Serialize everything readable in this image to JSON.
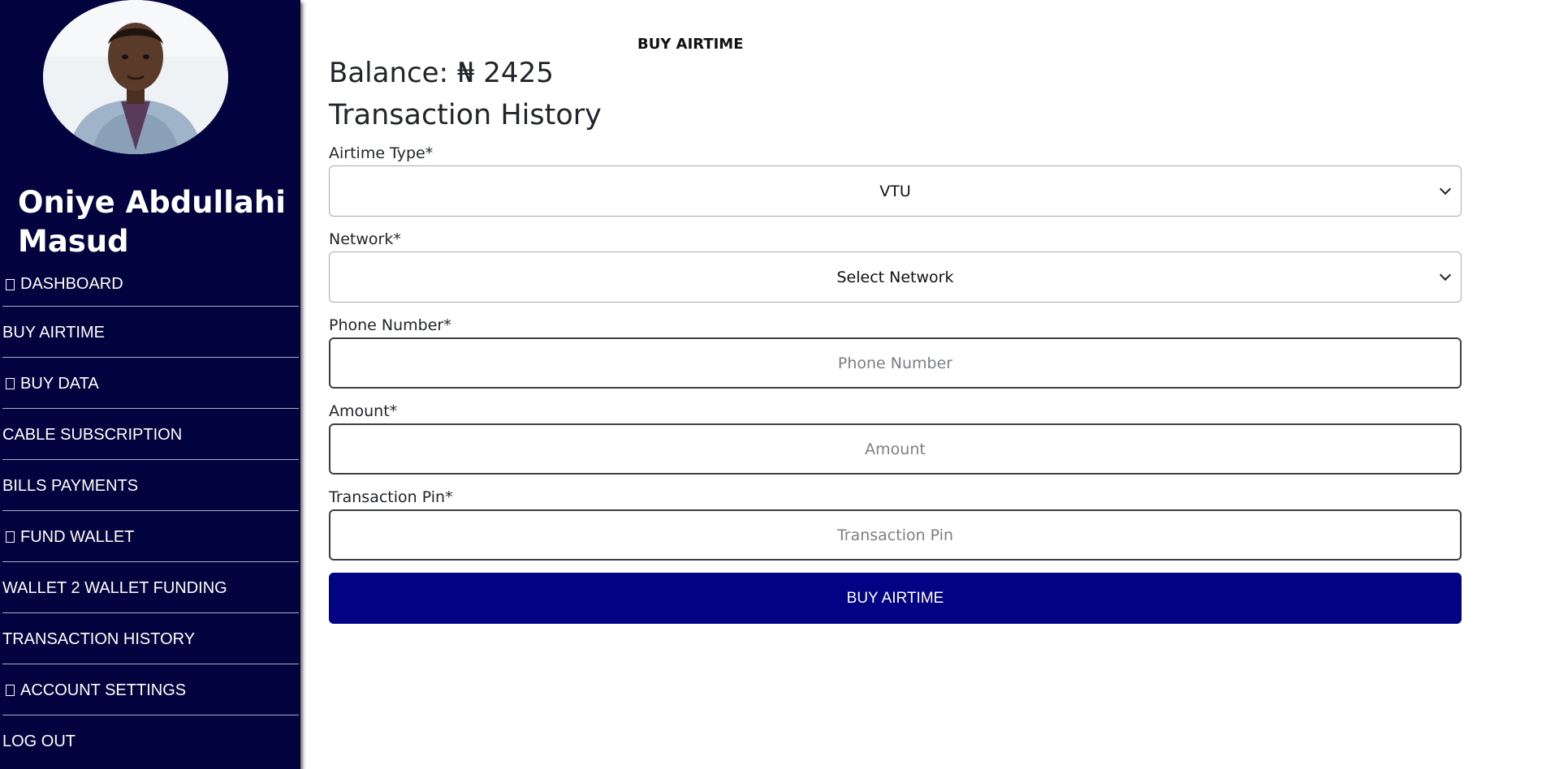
{
  "page": {
    "heading": "BUY AIRTIME"
  },
  "user": {
    "name": "Oniye Abdullahi Masud"
  },
  "sidebar": {
    "items": [
      {
        "label": "DASHBOARD",
        "icon": "placeholder-box-icon"
      },
      {
        "label": "BUY AIRTIME"
      },
      {
        "label": "BUY DATA",
        "icon": "placeholder-box-icon"
      },
      {
        "label": "CABLE SUBSCRIPTION"
      },
      {
        "label": "BILLS PAYMENTS"
      },
      {
        "label": "FUND WALLET",
        "icon": "placeholder-box-icon"
      },
      {
        "label": "WALLET 2 WALLET FUNDING"
      },
      {
        "label": "TRANSACTION HISTORY"
      },
      {
        "label": "ACCOUNT SETTINGS",
        "icon": "placeholder-box-icon"
      },
      {
        "label": "LOG OUT"
      }
    ]
  },
  "main": {
    "balance": "Balance: ₦ 2425",
    "history_title": "Transaction History",
    "form": {
      "airtime_type": {
        "label": "Airtime Type*",
        "value": "VTU"
      },
      "network": {
        "label": "Network*",
        "value": "Select Network"
      },
      "phone": {
        "label": "Phone Number*",
        "placeholder": "Phone Number"
      },
      "amount": {
        "label": "Amount*",
        "placeholder": "Amount"
      },
      "pin": {
        "label": "Transaction Pin*",
        "placeholder": "Transaction Pin"
      },
      "submit_label": "BUY AIRTIME"
    }
  },
  "colors": {
    "sidebar_bg": "#03033f",
    "button_bg": "#020285",
    "text": "#212529"
  }
}
